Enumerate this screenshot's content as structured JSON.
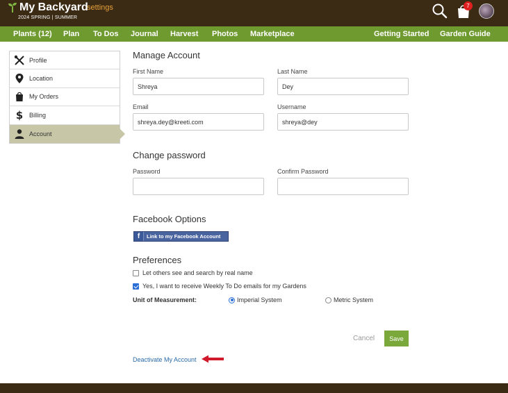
{
  "header": {
    "brand": "My Backyard",
    "section": "settings",
    "season": "2024 SPRING | SUMMER",
    "cart_count": "7"
  },
  "nav": {
    "left": [
      "Plants (12)",
      "Plan",
      "To Dos",
      "Journal",
      "Harvest",
      "Photos",
      "Marketplace"
    ],
    "right": [
      "Getting Started",
      "Garden Guide"
    ]
  },
  "sidebar": {
    "items": [
      {
        "label": "Profile",
        "icon": "tools-icon"
      },
      {
        "label": "Location",
        "icon": "location-pin-icon"
      },
      {
        "label": "My Orders",
        "icon": "shopping-bag-icon"
      },
      {
        "label": "Billing",
        "icon": "dollar-icon"
      },
      {
        "label": "Account",
        "icon": "user-icon"
      }
    ],
    "active": "Account"
  },
  "manage": {
    "title": "Manage Account",
    "first_name_label": "First Name",
    "first_name": "Shreya",
    "last_name_label": "Last Name",
    "last_name": "Dey",
    "email_label": "Email",
    "email": "shreya.dey@kreeti.com",
    "username_label": "Username",
    "username": "shreya@dey"
  },
  "password": {
    "title": "Change password",
    "password_label": "Password",
    "confirm_label": "Confirm Password"
  },
  "facebook": {
    "title": "Facebook Options",
    "button": "Link to my Facebook Account"
  },
  "preferences": {
    "title": "Preferences",
    "real_name": "Let others see and search by real name",
    "real_name_checked": false,
    "weekly": "Yes, I want to receive Weekly To Do emails for my Gardens",
    "weekly_checked": true,
    "uom_label": "Unit of Measurement:",
    "imperial": "Imperial System",
    "metric": "Metric System",
    "selected_unit": "Imperial System"
  },
  "actions": {
    "cancel": "Cancel",
    "save": "Save",
    "deactivate": "Deactivate My Account"
  },
  "colors": {
    "header_bg": "#3b2a14",
    "nav_bg": "#6f9a2f",
    "accent_orange": "#e8a13a",
    "save_green": "#7aa83a",
    "link_blue": "#2a6aa8",
    "arrow_red": "#d0192a"
  }
}
